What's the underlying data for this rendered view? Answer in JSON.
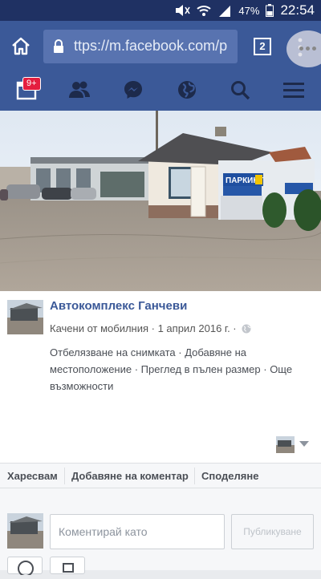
{
  "status_bar": {
    "battery": "47%",
    "time": "22:54"
  },
  "browser": {
    "url": "ttps://m.facebook.com/p",
    "tab_count": "2"
  },
  "fb_nav": {
    "notifications_badge": "9+"
  },
  "post": {
    "page_name": "Автокомплекс Ганчеви",
    "meta": "Качени от мобилния · 1 април 2016 г. ·",
    "links": [
      "Отбелязване на снимката",
      "Добавяне на местоположение",
      "Преглед в пълен размер",
      "Още възможности"
    ]
  },
  "actions": {
    "like": "Харесвам",
    "comment": "Добавяне на коментар",
    "share": "Споделяне"
  },
  "comment": {
    "placeholder": "Коментирай като",
    "post_button": "Публикуване"
  },
  "colors": {
    "facebook_blue": "#3b5998",
    "status_bar": "#1f3163",
    "badge_red": "#e41e3f"
  },
  "photo": {
    "sign_text": "ПАРКИНГ"
  }
}
